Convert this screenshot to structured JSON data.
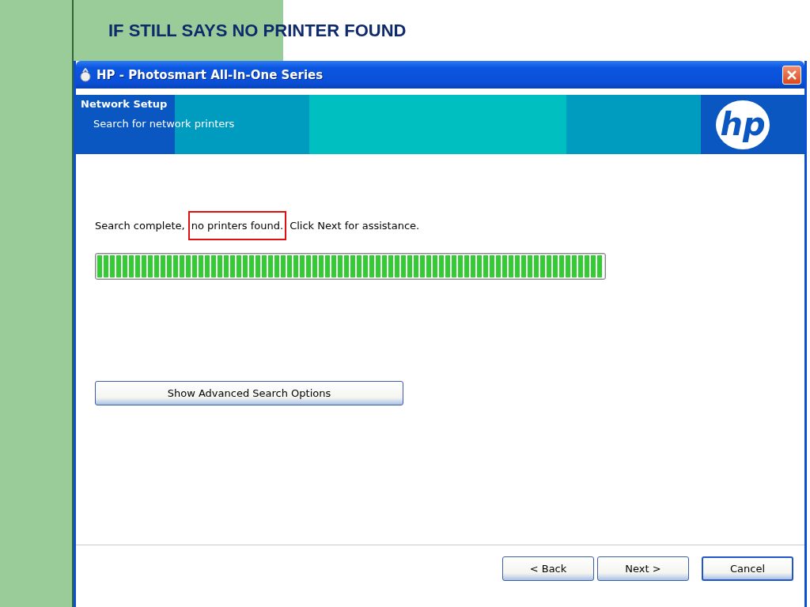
{
  "slide": {
    "title": "IF STILL SAYS NO PRINTER FOUND"
  },
  "window": {
    "title": "HP - Photosmart All-In-One Series",
    "logo": "hp"
  },
  "header": {
    "title": "Network Setup",
    "subtitle": "Search for network printers"
  },
  "message": {
    "before": "Search complete,",
    "highlighted": "no printers found.",
    "after": "Click Next for assistance."
  },
  "progress": {
    "level": 1
  },
  "advanced_button": "Show Advanced Search Options",
  "buttons": [
    {
      "label": "< Back",
      "kind": "normal"
    },
    {
      "label": "Next >",
      "kind": "normal"
    },
    {
      "label": "Cancel",
      "kind": "default"
    }
  ]
}
